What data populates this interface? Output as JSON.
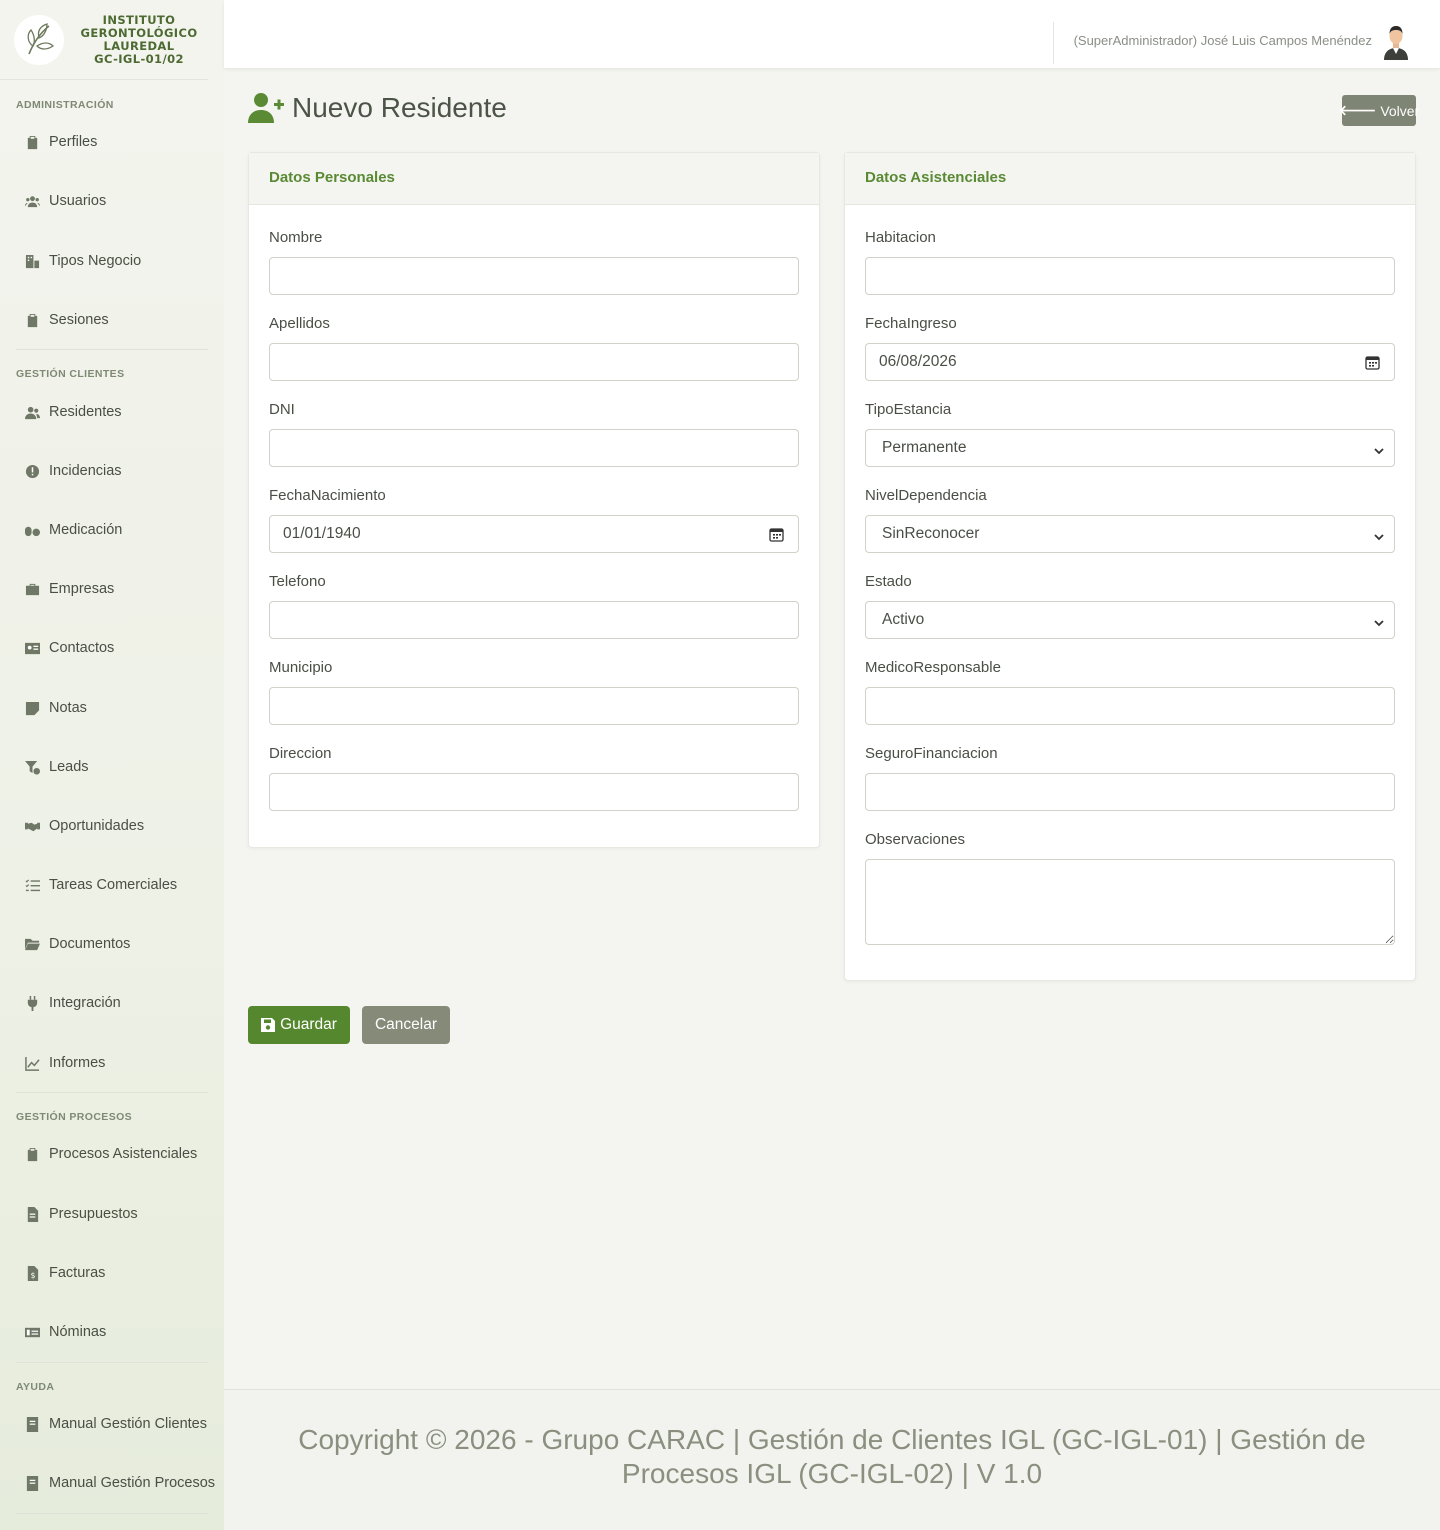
{
  "brand": {
    "lines": [
      "INSTITUTO",
      "GERONTOLÓGICO",
      "LAUREDAL",
      "GC-IGL-01/02"
    ],
    "logo_icon": "leaf-logo-icon"
  },
  "sidebar": {
    "sections": [
      {
        "title": "ADMINISTRACIÓN",
        "items": [
          {
            "label": "Perfiles",
            "icon": "clipboard-icon"
          },
          {
            "label": "Usuarios",
            "icon": "users-icon"
          },
          {
            "label": "Tipos Negocio",
            "icon": "building-icon"
          },
          {
            "label": "Sesiones",
            "icon": "clipboard-icon"
          }
        ]
      },
      {
        "title": "GESTIÓN CLIENTES",
        "items": [
          {
            "label": "Residentes",
            "icon": "user-group-icon"
          },
          {
            "label": "Incidencias",
            "icon": "alert-icon"
          },
          {
            "label": "Medicación",
            "icon": "pills-icon"
          },
          {
            "label": "Empresas",
            "icon": "briefcase-icon"
          },
          {
            "label": "Contactos",
            "icon": "id-card-icon"
          },
          {
            "label": "Notas",
            "icon": "note-icon"
          },
          {
            "label": "Leads",
            "icon": "filter-icon"
          },
          {
            "label": "Oportunidades",
            "icon": "handshake-icon"
          },
          {
            "label": "Tareas Comerciales",
            "icon": "tasks-icon"
          },
          {
            "label": "Documentos",
            "icon": "folder-icon"
          },
          {
            "label": "Integración",
            "icon": "plug-icon"
          },
          {
            "label": "Informes",
            "icon": "chart-line-icon"
          }
        ]
      },
      {
        "title": "GESTIÓN PROCESOS",
        "items": [
          {
            "label": "Procesos Asistenciales",
            "icon": "clipboard-icon"
          },
          {
            "label": "Presupuestos",
            "icon": "file-icon"
          },
          {
            "label": "Facturas",
            "icon": "invoice-icon"
          },
          {
            "label": "Nóminas",
            "icon": "money-icon"
          }
        ]
      },
      {
        "title": "AYUDA",
        "items": [
          {
            "label": "Manual Gestión Clientes",
            "icon": "book-icon"
          },
          {
            "label": "Manual Gestión Procesos",
            "icon": "book-icon"
          }
        ]
      }
    ]
  },
  "topbar": {
    "user": "(SuperAdministrador) José Luis Campos Menéndez",
    "avatar_icon": "user-avatar-icon"
  },
  "header": {
    "title": "Nuevo Residente",
    "title_icon": "user-plus-icon",
    "back_label": "Volver",
    "back_icon": "arrow-left-icon"
  },
  "personal": {
    "title": "Datos Personales",
    "fields": {
      "nombre": {
        "label": "Nombre",
        "value": ""
      },
      "apellidos": {
        "label": "Apellidos",
        "value": ""
      },
      "dni": {
        "label": "DNI",
        "value": ""
      },
      "fecha_nacimiento": {
        "label": "FechaNacimiento",
        "value": "01/01/1940"
      },
      "telefono": {
        "label": "Telefono",
        "value": ""
      },
      "municipio": {
        "label": "Municipio",
        "value": ""
      },
      "direccion": {
        "label": "Direccion",
        "value": ""
      }
    }
  },
  "asistencial": {
    "title": "Datos Asistenciales",
    "fields": {
      "habitacion": {
        "label": "Habitacion",
        "value": ""
      },
      "fecha_ingreso": {
        "label": "FechaIngreso",
        "value": "06/08/2026"
      },
      "tipo_estancia": {
        "label": "TipoEstancia",
        "value": "Permanente"
      },
      "nivel_dependencia": {
        "label": "NivelDependencia",
        "value": "SinReconocer"
      },
      "estado": {
        "label": "Estado",
        "value": "Activo"
      },
      "medico": {
        "label": "MedicoResponsable",
        "value": ""
      },
      "seguro": {
        "label": "SeguroFinanciacion",
        "value": ""
      },
      "observaciones": {
        "label": "Observaciones",
        "value": ""
      }
    }
  },
  "actions": {
    "save_label": "Guardar",
    "save_icon": "save-icon",
    "cancel_label": "Cancelar"
  },
  "footer": {
    "text": "Copyright © 2026 - Grupo CARAC | Gestión de Clientes IGL (GC-IGL-01) | Gestión de Procesos IGL (GC-IGL-02) | V 1.0"
  },
  "colors": {
    "accent": "#5a8a34",
    "save_button": "#55882e",
    "secondary_button": "#858a79"
  }
}
